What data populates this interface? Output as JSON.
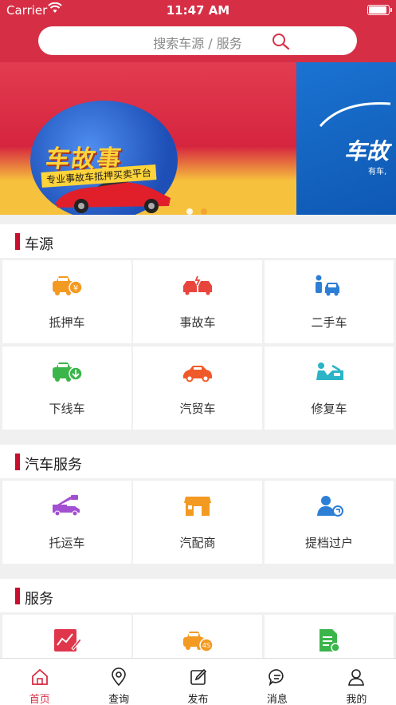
{
  "status_bar": {
    "carrier": "Carrier",
    "time": "11:47 AM"
  },
  "search": {
    "placeholder": "搜索车源 / 服务"
  },
  "banner": {
    "slide1_title": "车故事",
    "slide1_subtitle": "专业事故车抵押买卖平台",
    "slide2_title": "车故",
    "slide2_subtitle": "有车,"
  },
  "sections": [
    {
      "title": "车源",
      "items": [
        {
          "label": "抵押车",
          "icon": "mortgage-car-icon",
          "color": "#f39a22"
        },
        {
          "label": "事故车",
          "icon": "accident-car-icon",
          "color": "#e8453c"
        },
        {
          "label": "二手车",
          "icon": "used-car-icon",
          "color": "#2d7fd6"
        },
        {
          "label": "下线车",
          "icon": "offline-car-icon",
          "color": "#3ab54a"
        },
        {
          "label": "汽贸车",
          "icon": "dealer-car-icon",
          "color": "#f05a2b"
        },
        {
          "label": "修复车",
          "icon": "repair-car-icon",
          "color": "#2bb3c7"
        }
      ]
    },
    {
      "title": "汽车服务",
      "items": [
        {
          "label": "托运车",
          "icon": "tow-truck-icon",
          "color": "#a34fd1"
        },
        {
          "label": "汽配商",
          "icon": "parts-shop-icon",
          "color": "#f39a22"
        },
        {
          "label": "提档过户",
          "icon": "transfer-icon",
          "color": "#2d7fd6"
        }
      ]
    },
    {
      "title": "服务",
      "items": [
        {
          "label": "",
          "icon": "chart-pen-icon",
          "color": "#e0364c"
        },
        {
          "label": "",
          "icon": "4s-car-icon",
          "color": "#f39a22"
        },
        {
          "label": "",
          "icon": "document-icon",
          "color": "#3ab54a"
        }
      ]
    }
  ],
  "tabbar": [
    {
      "label": "首页",
      "icon": "home-icon",
      "active": true
    },
    {
      "label": "查询",
      "icon": "location-pin-icon",
      "active": false
    },
    {
      "label": "发布",
      "icon": "edit-icon",
      "active": false
    },
    {
      "label": "消息",
      "icon": "message-icon",
      "active": false
    },
    {
      "label": "我的",
      "icon": "profile-icon",
      "active": false
    }
  ],
  "colors": {
    "brand": "#d62f45",
    "accent_bar": "#c8102e"
  }
}
